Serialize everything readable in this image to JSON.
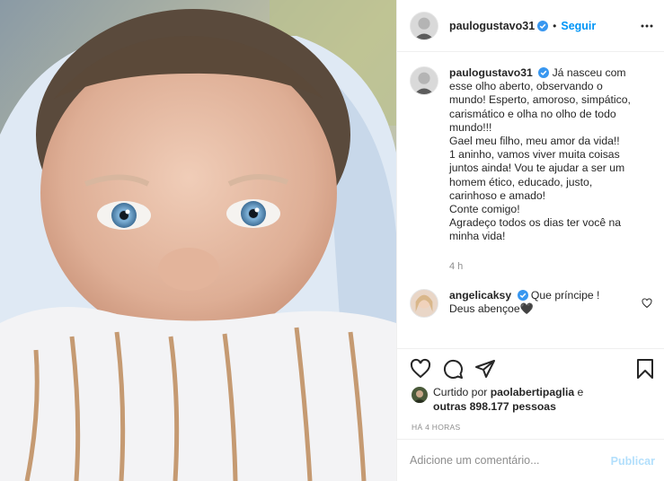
{
  "post": {
    "username": "paulogustavo31",
    "follow_label": "Seguir",
    "separator": "•",
    "caption": {
      "username": "paulogustavo31",
      "text": "Já nasceu com esse olho aberto, observando o mundo! Esperto, amoroso, simpático, carismático e olha no olho de todo mundo!!!\nGael meu filho, meu amor da vida!!\n1 aninho, vamos viver muita coisas juntos ainda! Vou te ajudar a ser um homem ético, educado, justo, carinhoso e amado!\nConte comigo!\nAgradeço todos os dias ter você na minha vida!",
      "time": "4 h"
    },
    "comments": [
      {
        "username": "angelicaksy",
        "text": "Que príncipe ! Deus abençoe🖤"
      }
    ],
    "likes": {
      "prefix": "Curtido por",
      "user": "paolabertipaglia",
      "conj": "e",
      "others": "outras 898.177 pessoas"
    },
    "posted_ago": "HÁ 4 HORAS",
    "add_comment": {
      "placeholder": "Adicione um comentário...",
      "publish_label": "Publicar"
    }
  },
  "colors": {
    "link": "#0095f6",
    "publish_disabled": "#b2dffc",
    "muted": "#8e8e8e",
    "text": "#262626"
  },
  "icons": [
    "more-options-icon",
    "verified-badge-icon",
    "heart-icon",
    "comment-icon",
    "share-icon",
    "bookmark-icon",
    "like-comment-heart-icon"
  ]
}
